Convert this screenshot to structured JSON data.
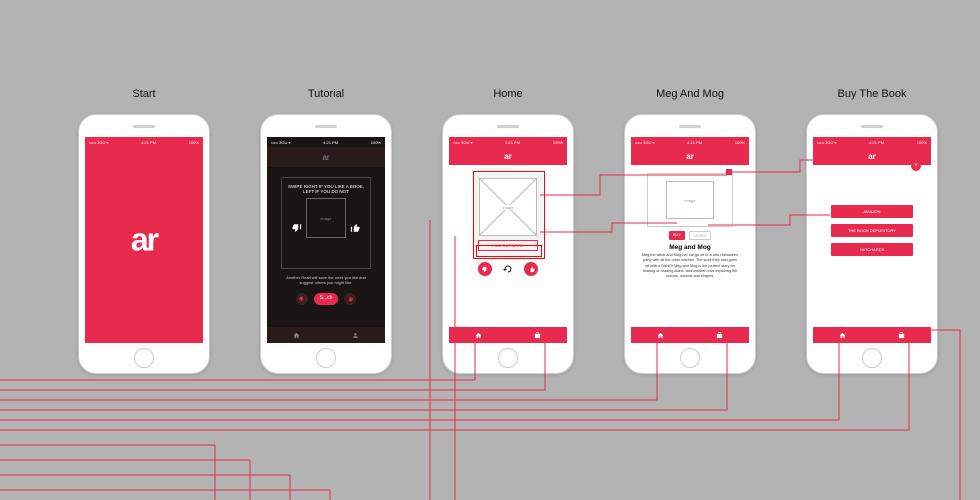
{
  "accent": "#e92a4f",
  "screens": {
    "start": {
      "label": "Start",
      "status": {
        "left": "••••• 3GU ▾",
        "time": "4:21 PM",
        "right": "100%"
      },
      "logo": "ar"
    },
    "tutorial": {
      "label": "Tutorial",
      "status": {
        "left": "••••• 3GU ▾",
        "time": "4:21 PM",
        "right": "100%"
      },
      "header_logo": "ar",
      "instruction": "SWIPE RIGHT IF YOU LIKE A BOOK, LEFT IF YOU DO NOT",
      "img_placeholder": "image",
      "body": "Another Read will save the ones you like and suggest others you might like.",
      "skip": "S...ch",
      "nav": [
        "home",
        "profile"
      ]
    },
    "home": {
      "label": "Home",
      "header_logo": "ar",
      "card_img_placeholder": "image",
      "more_btn": "FIND OUT MORE",
      "actions": [
        "thumb-down",
        "refresh",
        "thumb-up"
      ],
      "nav": [
        "home",
        "bag"
      ]
    },
    "detail": {
      "label": "Meg And Mog",
      "header_logo": "ar",
      "img_placeholder": "image",
      "tags": [
        "BUY",
        "MORE"
      ],
      "title": "Meg and Mog",
      "body": "Meg the witch and Mog her cat go off to a wild Halloween party with all the other witches. The spell they cast goes off with a BANG! Meg and Mog is the perfect story for sharing or reading alone, and children love exploring the colours, sounds and shapes.",
      "nav": [
        "home",
        "bag"
      ]
    },
    "buy": {
      "label": "Buy The Book",
      "header_logo": "ar",
      "close": "×",
      "options": [
        "AMAZON",
        "THE BOOK DEPOSITORY",
        "HATCHARDS"
      ],
      "nav": [
        "home",
        "bag"
      ]
    }
  }
}
